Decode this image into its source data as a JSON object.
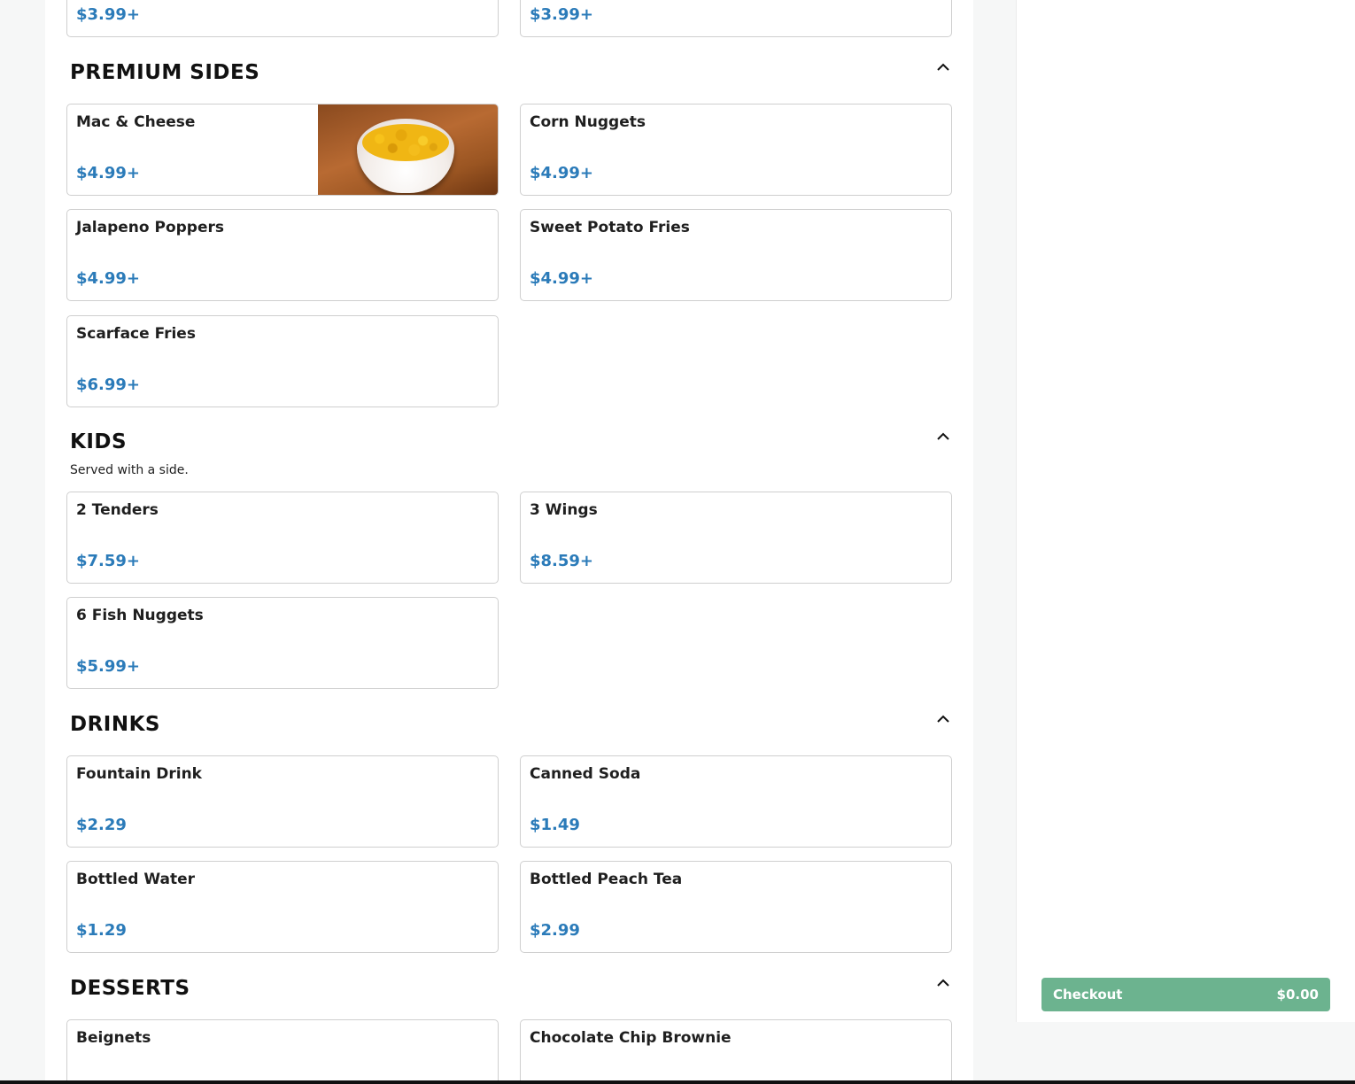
{
  "top_row": {
    "left_price": "$3.99+",
    "right_price": "$3.99+"
  },
  "sections": {
    "premium_sides": {
      "title": "PREMIUM SIDES",
      "items": [
        {
          "name": "Mac & Cheese",
          "price": "$4.99+"
        },
        {
          "name": "Corn Nuggets",
          "price": "$4.99+"
        },
        {
          "name": "Jalapeno Poppers",
          "price": "$4.99+"
        },
        {
          "name": "Sweet Potato Fries",
          "price": "$4.99+"
        },
        {
          "name": "Scarface Fries",
          "price": "$6.99+"
        }
      ]
    },
    "kids": {
      "title": "KIDS",
      "description": "Served with a side.",
      "items": [
        {
          "name": "2 Tenders",
          "price": "$7.59+"
        },
        {
          "name": "3 Wings",
          "price": "$8.59+"
        },
        {
          "name": "6 Fish Nuggets",
          "price": "$5.99+"
        }
      ]
    },
    "drinks": {
      "title": "DRINKS",
      "items": [
        {
          "name": "Fountain Drink",
          "price": "$2.29"
        },
        {
          "name": "Canned Soda",
          "price": "$1.49"
        },
        {
          "name": "Bottled Water",
          "price": "$1.29"
        },
        {
          "name": "Bottled Peach Tea",
          "price": "$2.99"
        }
      ]
    },
    "desserts": {
      "title": "DESSERTS",
      "items": [
        {
          "name": "Beignets"
        },
        {
          "name": "Chocolate Chip Brownie"
        }
      ]
    }
  },
  "icons": {
    "section_toggle": "chevron-up-icon",
    "item_photo": "mac-and-cheese-photo"
  },
  "checkout": {
    "label": "Checkout",
    "total": "$0.00"
  },
  "colors": {
    "price": "#2b7bb9",
    "checkout_button": "#6cb38f",
    "card_border": "#cfcfcf"
  }
}
